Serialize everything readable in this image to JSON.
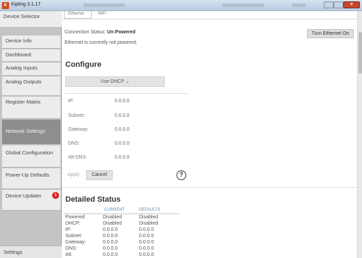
{
  "window": {
    "title": "Kipling 3.1.17",
    "app_icon_text": "K"
  },
  "sidebar": {
    "items": [
      {
        "label": "Device Selector"
      },
      {
        "label": "Device Info"
      },
      {
        "label": "Dashboard"
      },
      {
        "label": "Analog Inputs"
      },
      {
        "label": "Analog Outputs"
      },
      {
        "label": "Register Matrix"
      },
      {
        "label": "Network Settings"
      },
      {
        "label": "Global Configuration"
      },
      {
        "label": "Power-Up Defaults"
      },
      {
        "label": "Device Updater",
        "badge": "1"
      }
    ],
    "settings_label": "Settings"
  },
  "tabs": [
    {
      "label": "Ethernet"
    },
    {
      "label": "WiFi"
    }
  ],
  "ethernet": {
    "status_prefix": "Connection Status:",
    "status_value": "Un-Powered",
    "message": "Ethernet is currently not powered.",
    "power_button": "Turn Ethernet On"
  },
  "configure": {
    "heading": "Configure",
    "dhcp_select": "Use DHCP ⌄",
    "rows": [
      {
        "label": "IP:",
        "value": "0.0.0.0"
      },
      {
        "label": "Subnet:",
        "value": "0.0.0.0"
      },
      {
        "label": "Gateway:",
        "value": "0.0.0.0"
      },
      {
        "label": "DNS:",
        "value": "0.0.0.0"
      },
      {
        "label": "Alt-DNS:",
        "value": "0.0.0.0"
      }
    ],
    "apply_label": "Apply",
    "cancel_label": "Cancel",
    "help_label": "?"
  },
  "detailed_status": {
    "heading": "Detailed Status",
    "col_current": "CURRENT",
    "col_defaults": "DEFAULTS",
    "rows": [
      {
        "label": "Powered:",
        "current": "Disabled",
        "defaults": "Disabled"
      },
      {
        "label": "DHCP:",
        "current": "Disabled",
        "defaults": "Disabled"
      },
      {
        "label": "IP:",
        "current": "0.0.0.0",
        "defaults": "0.0.0.0"
      },
      {
        "label": "Subnet:",
        "current": "0.0.0.0",
        "defaults": "0.0.0.0"
      },
      {
        "label": "Gateway:",
        "current": "0.0.0.0",
        "defaults": "0.0.0.0"
      },
      {
        "label": "DNS:",
        "current": "0.0.0.0",
        "defaults": "0.0.0.0"
      },
      {
        "label": "Alt:",
        "current": "0.0.0.0",
        "defaults": "0.0.0.0"
      }
    ]
  },
  "colors": {
    "sidebar_bg": "#c4c4c4",
    "sidebar_active": "#8e8e8e",
    "badge": "#d8231d",
    "status_header": "#5c8ab4"
  }
}
